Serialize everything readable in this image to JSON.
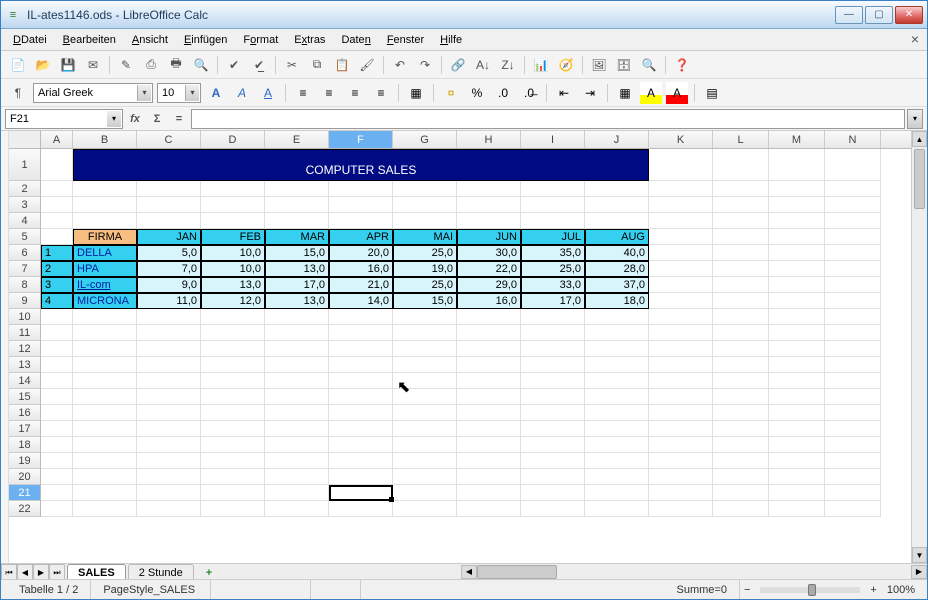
{
  "window": {
    "title": "IL-ates1146.ods - LibreOffice Calc",
    "doc_icon": "≡"
  },
  "menu": {
    "items": [
      "Datei",
      "Bearbeiten",
      "Ansicht",
      "Einfügen",
      "Format",
      "Extras",
      "Daten",
      "Fenster",
      "Hilfe"
    ],
    "close": "×"
  },
  "font": {
    "name": "Arial Greek",
    "size": "10"
  },
  "cellref": {
    "value": "F21"
  },
  "columns": [
    "A",
    "B",
    "C",
    "D",
    "E",
    "F",
    "G",
    "H",
    "I",
    "J",
    "K",
    "L",
    "M",
    "N"
  ],
  "sel_col": "F",
  "sel_row": "21",
  "chart_data": {
    "type": "table",
    "title": "COMPUTER SALES",
    "header_corner": "FIRMA",
    "months": [
      "JAN",
      "FEB",
      "MAR",
      "APR",
      "MAI",
      "JUN",
      "JUL",
      "AUG"
    ],
    "rows": [
      {
        "idx": "1",
        "firm": "DELLA",
        "vals": [
          "5,0",
          "10,0",
          "15,0",
          "20,0",
          "25,0",
          "30,0",
          "35,0",
          "40,0"
        ]
      },
      {
        "idx": "2",
        "firm": "HPA",
        "vals": [
          "7,0",
          "10,0",
          "13,0",
          "16,0",
          "19,0",
          "22,0",
          "25,0",
          "28,0"
        ]
      },
      {
        "idx": "3",
        "firm": "IL-com",
        "vals": [
          "9,0",
          "13,0",
          "17,0",
          "21,0",
          "25,0",
          "29,0",
          "33,0",
          "37,0"
        ]
      },
      {
        "idx": "4",
        "firm": "MICRONA",
        "vals": [
          "11,0",
          "12,0",
          "13,0",
          "14,0",
          "15,0",
          "16,0",
          "17,0",
          "18,0"
        ]
      }
    ]
  },
  "tabs": {
    "active": "SALES",
    "other": "2 Stunde",
    "add": "+"
  },
  "status": {
    "sheet": "Tabelle 1 / 2",
    "style": "PageStyle_SALES",
    "sum": "Summe=0",
    "zoom_minus": "−",
    "zoom_plus": "+",
    "zoom": "100%"
  },
  "fx": {
    "fx": "fx",
    "sum": "Σ",
    "eq": "="
  }
}
